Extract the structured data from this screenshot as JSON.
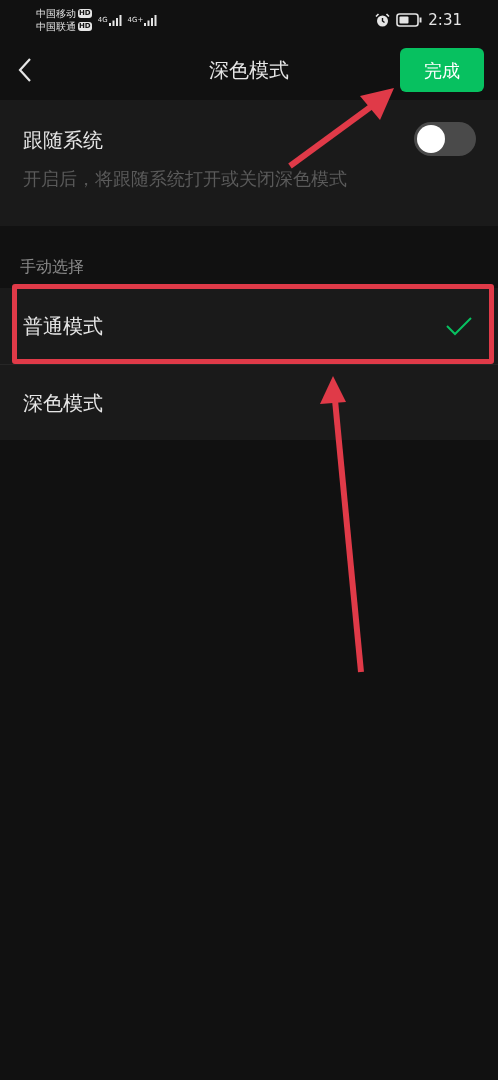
{
  "status_bar": {
    "carriers": [
      {
        "name": "中国移动",
        "badge": "HD"
      },
      {
        "name": "中国联通",
        "badge": "HD"
      }
    ],
    "networks": [
      "4G",
      "4G+"
    ],
    "time": "2:31"
  },
  "header": {
    "title": "深色模式",
    "done_button": "完成"
  },
  "follow_system": {
    "label": "跟随系统",
    "description": "开启后，将跟随系统打开或关闭深色模式",
    "on": false
  },
  "manual": {
    "label": "手动选择",
    "options": [
      {
        "label": "普通模式",
        "selected": true
      },
      {
        "label": "深色模式",
        "selected": false
      }
    ]
  }
}
